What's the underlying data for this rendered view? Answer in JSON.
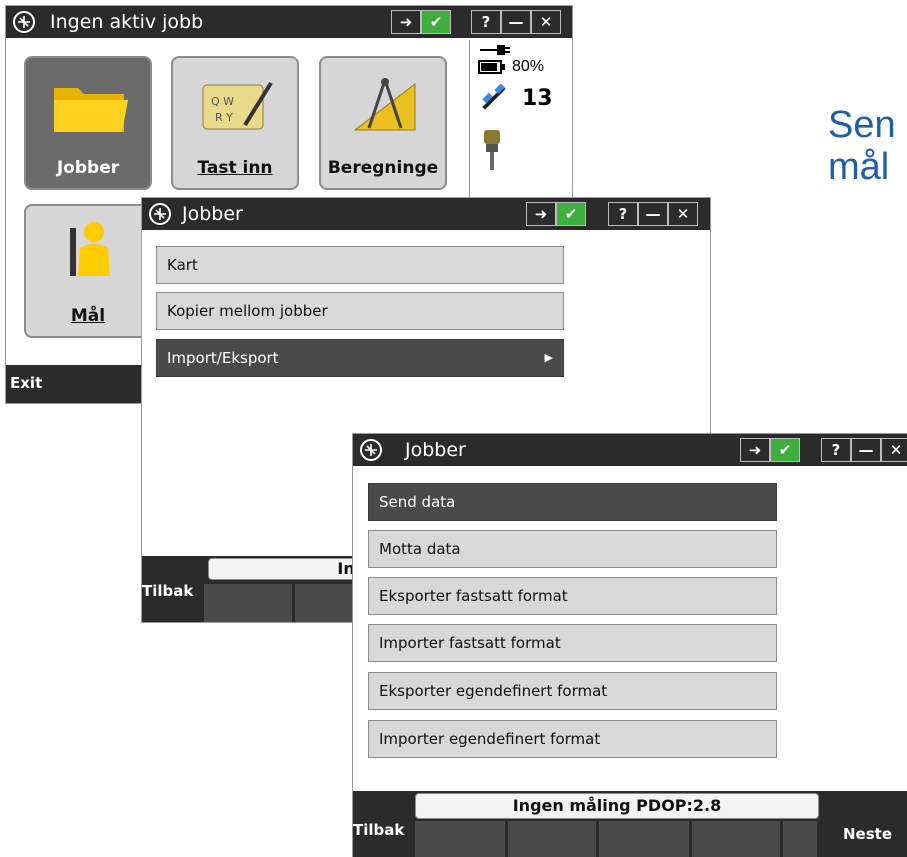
{
  "slide_heading": {
    "line1": "Sen",
    "line2": "mål"
  },
  "main_window": {
    "title": "Ingen aktiv jobb",
    "title_buttons": [
      "?",
      "—",
      "✕"
    ],
    "tiles": [
      {
        "label": "Jobber",
        "icon": "folder-icon"
      },
      {
        "label": "Tast inn",
        "icon": "keyboard-pen-icon"
      },
      {
        "label": "Beregninge",
        "icon": "compass-triangle-icon"
      },
      {
        "label": "Mål",
        "icon": "surveyor-icon"
      }
    ],
    "status_panel": {
      "battery": "80%",
      "satellites": "13"
    },
    "softkeys": {
      "exit": "Exit"
    }
  },
  "jobber_window_1": {
    "title": "Jobber",
    "title_buttons": [
      "?",
      "—",
      "✕"
    ],
    "items": [
      {
        "label": "Kart",
        "submenu": false
      },
      {
        "label": "Kopier mellom jobber",
        "submenu": false
      },
      {
        "label": "Import/Eksport",
        "submenu": true
      }
    ],
    "status": "Ingen m",
    "softkeys": {
      "back": "Tilbak"
    }
  },
  "jobber_window_2": {
    "title": "Jobber",
    "title_buttons": [
      "?",
      "—",
      "✕"
    ],
    "items": [
      {
        "label": "Send data",
        "selected": true
      },
      {
        "label": "Motta data",
        "selected": false
      },
      {
        "label": "Eksporter fastsatt format",
        "selected": false
      },
      {
        "label": "Importer fastsatt format",
        "selected": false
      },
      {
        "label": "Eksporter egendefinert format",
        "selected": false
      },
      {
        "label": "Importer egendefinert format",
        "selected": false
      }
    ],
    "status": "Ingen måling  PDOP:2.8",
    "softkeys": {
      "back": "Tilbak",
      "next": "Neste"
    }
  },
  "colors": {
    "titlebar": "#2b2b2b",
    "accent_green": "#3fae3f",
    "heading_blue": "#1f5fa8",
    "button_gray": "#d8d8d8"
  }
}
